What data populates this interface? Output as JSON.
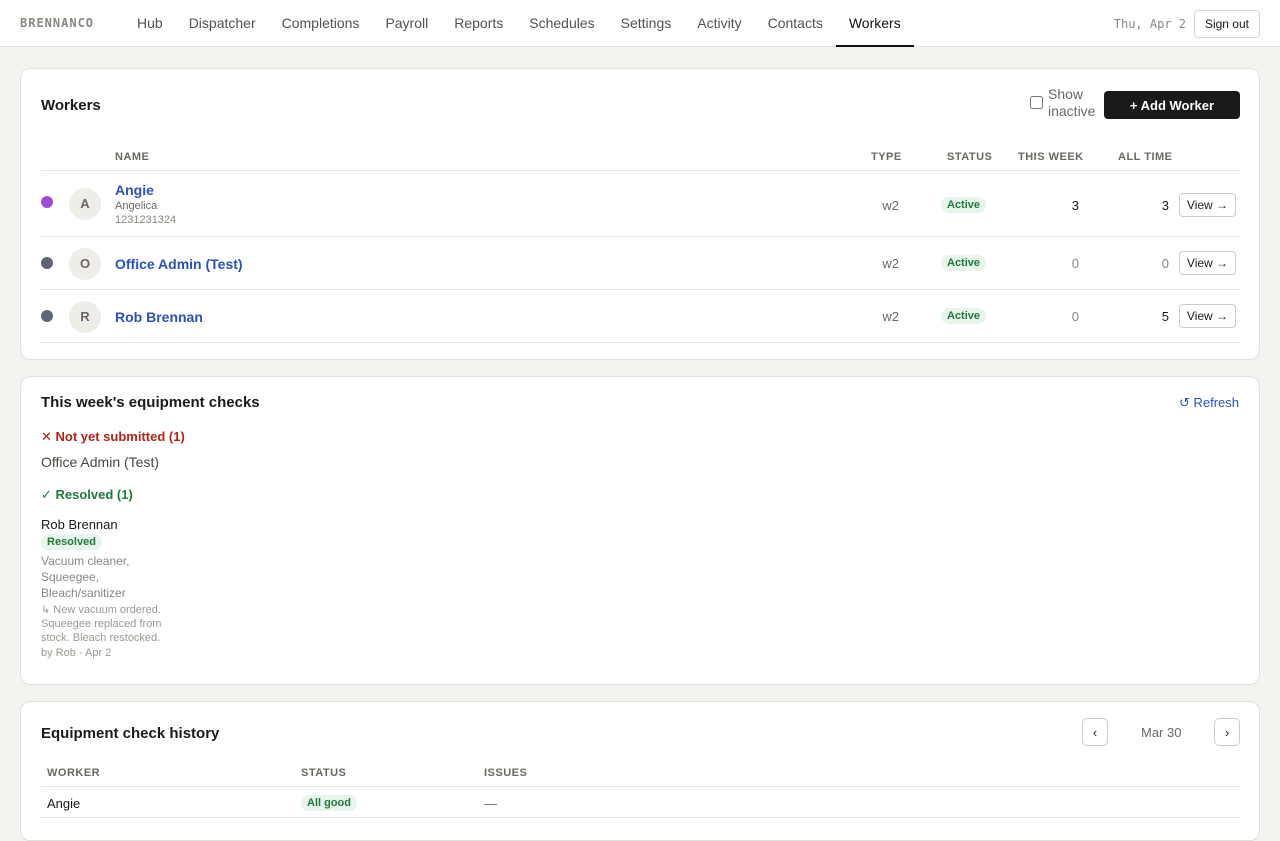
{
  "nav": {
    "brand": "BRENNANCO",
    "links": [
      "Hub",
      "Dispatcher",
      "Completions",
      "Payroll",
      "Reports",
      "Schedules",
      "Settings",
      "Activity",
      "Contacts",
      "Workers"
    ],
    "active": "Workers",
    "date": "Thu, Apr 2",
    "signout_label": "Sign out"
  },
  "workers": {
    "title": "Workers",
    "show_inactive_label": "Show inactive",
    "show_inactive_checked": false,
    "add_label": "+ Add Worker",
    "columns": {
      "name": "NAME",
      "type": "TYPE",
      "status": "STATUS",
      "this_week": "THIS WEEK",
      "all_time": "ALL TIME"
    },
    "rows": [
      {
        "dot_color": "#a04bd1",
        "initial": "A",
        "name": "Angie",
        "sub": "Angelica",
        "sub2": "1231231324",
        "type": "w2",
        "status": "Active",
        "this_week": "3",
        "all_time": "3",
        "view_label": "View →"
      },
      {
        "dot_color": "#5f6577",
        "initial": "O",
        "name": "Office Admin (Test)",
        "sub": "",
        "sub2": "",
        "type": "w2",
        "status": "Active",
        "this_week": "0",
        "all_time": "0",
        "view_label": "View →"
      },
      {
        "dot_color": "#5f6577",
        "initial": "R",
        "name": "Rob Brennan",
        "sub": "",
        "sub2": "",
        "type": "w2",
        "status": "Active",
        "this_week": "0",
        "all_time": "5",
        "view_label": "View →"
      }
    ]
  },
  "equipment": {
    "title": "This week's equipment checks",
    "refresh_label": "↺ Refresh",
    "not_submitted_label": "✕ Not yet submitted (1)",
    "not_submitted_worker": "Office Admin (Test)",
    "resolved_label": "✓ Resolved (1)",
    "resolved_worker": "Rob Brennan",
    "resolved_badge": "Resolved",
    "resolved_items": "Vacuum cleaner, Squeegee, Bleach/sanitizer",
    "resolution_note": "↳ New vacuum ordered. Squeegee replaced from stock. Bleach restocked.",
    "resolution_by": "by Rob · Apr 2"
  },
  "history": {
    "title": "Equipment check history",
    "prev_label": "‹",
    "next_label": "›",
    "week_label": "Mar 30",
    "columns": {
      "worker": "WORKER",
      "status": "STATUS",
      "issues": "ISSUES"
    },
    "rows": [
      {
        "worker": "Angie",
        "status": "All good",
        "issues": "—"
      }
    ]
  },
  "colors": {
    "accent": "#1a1a1a",
    "link": "#2a52be",
    "success": "#1f7a3c",
    "danger": "#b42318"
  }
}
